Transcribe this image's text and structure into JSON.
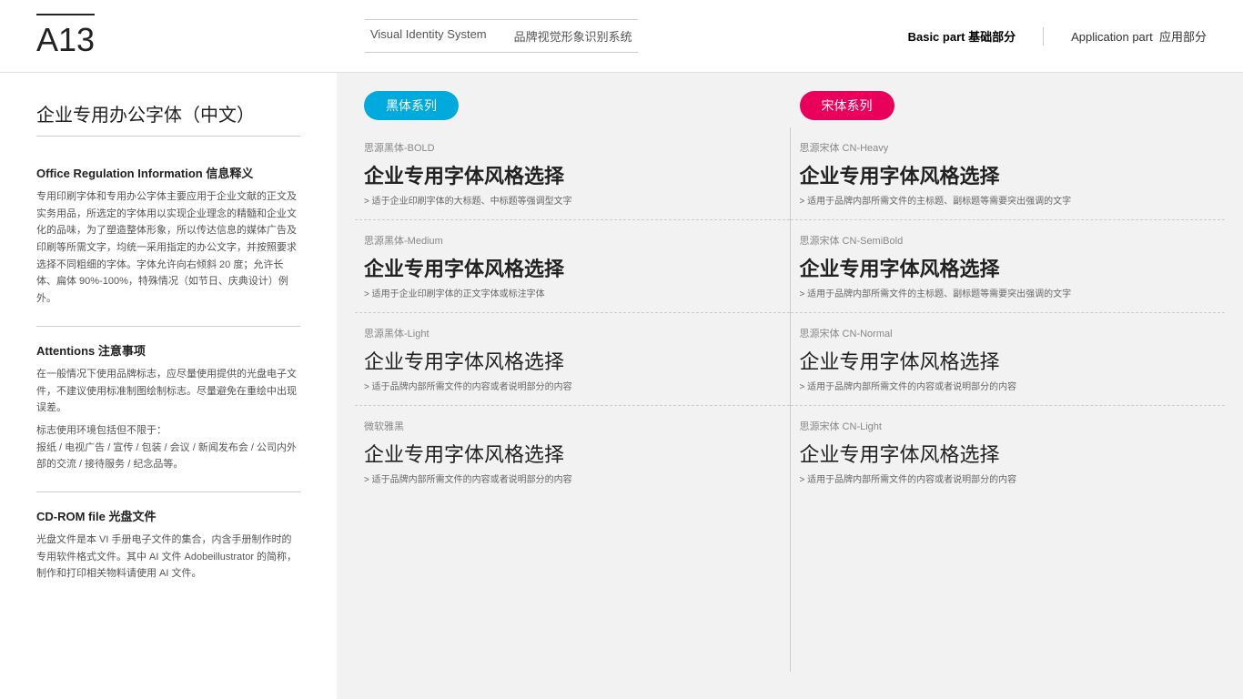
{
  "header": {
    "page_id": "A13",
    "vis_title_en": "Visual Identity System",
    "vis_title_cn": "品牌视觉形象识别系统",
    "nav_basic_en": "Basic part",
    "nav_basic_cn": "基础部分",
    "nav_app_en": "Application part",
    "nav_app_cn": "应用部分"
  },
  "left": {
    "page_title": "企业专用办公字体（中文）",
    "section1_title": "Office Regulation Information 信息释义",
    "section1_text": "专用印刷字体和专用办公字体主要应用于企业文献的正文及实务用品，所选定的字体用以实现企业理念的精髓和企业文化的品味，为了塑造整体形象，所以传达信息的媒体广告及印刷等所需文字，均统一采用指定的办公文字，并按照要求选择不同粗细的字体。字体允许向右倾斜 20 度；允许长体、扁体 90%-100%，特殊情况（如节日、庆典设计）例外。",
    "section2_title": "Attentions 注意事项",
    "section2_text1": "在一般情况下使用品牌标志，应尽量使用提供的光盘电子文件，不建议使用标准制图绘制标志。尽量避免在重绘中出现误差。",
    "section2_text2": "标志使用环境包括但不限于：\n报纸 / 电视广告 / 宣传 / 包装 / 会议 / 新闻发布会 / 公司内外部的交流 / 接待服务 / 纪念品等。",
    "section3_title": "CD-ROM file 光盘文件",
    "section3_text": "光盘文件是本 VI 手册电子文件的集合，内含手册制作时的专用软件格式文件。其中 AI 文件 Adobeillustrator 的简称，制作和打印相关物料请使用 AI 文件。"
  },
  "right": {
    "badge_left": "黑体系列",
    "badge_right": "宋体系列",
    "left_items": [
      {
        "label": "思源黑体-BOLD",
        "demo": "企业专用字体风格选择",
        "weight": "bold",
        "desc": "> 适于企业印刷字体的大标题、中标题等强调型文字"
      },
      {
        "label": "思源黑体-Medium",
        "demo": "企业专用字体风格选择",
        "weight": "medium",
        "desc": "> 适用于企业印刷字体的正文字体或标注字体"
      },
      {
        "label": "思源黑体-Light",
        "demo": "企业专用字体风格选择",
        "weight": "light",
        "desc": "> 适于品牌内部所需文件的内容或者说明部分的内容"
      },
      {
        "label": "微软雅黑",
        "demo": "企业专用字体风格选择",
        "weight": "light",
        "desc": "> 适于品牌内部所需文件的内容或者说明部分的内容"
      }
    ],
    "right_items": [
      {
        "label": "思源宋体 CN-Heavy",
        "demo": "企业专用字体风格选择",
        "weight": "bold",
        "desc": "> 适用于品牌内部所需文件的主标题、副标题等需要突出强调的文字"
      },
      {
        "label": "思源宋体 CN-SemiBold",
        "demo": "企业专用字体风格选择",
        "weight": "medium",
        "desc": "> 适用于品牌内部所需文件的主标题、副标题等需要突出强调的文字"
      },
      {
        "label": "思源宋体 CN-Normal",
        "demo": "企业专用字体风格选择",
        "weight": "light",
        "desc": "> 适用于品牌内部所需文件的内容或者说明部分的内容"
      },
      {
        "label": "思源宋体 CN-Light",
        "demo": "企业专用字体风格选择",
        "weight": "light",
        "desc": "> 适用于品牌内部所需文件的内容或者说明部分的内容"
      }
    ]
  }
}
